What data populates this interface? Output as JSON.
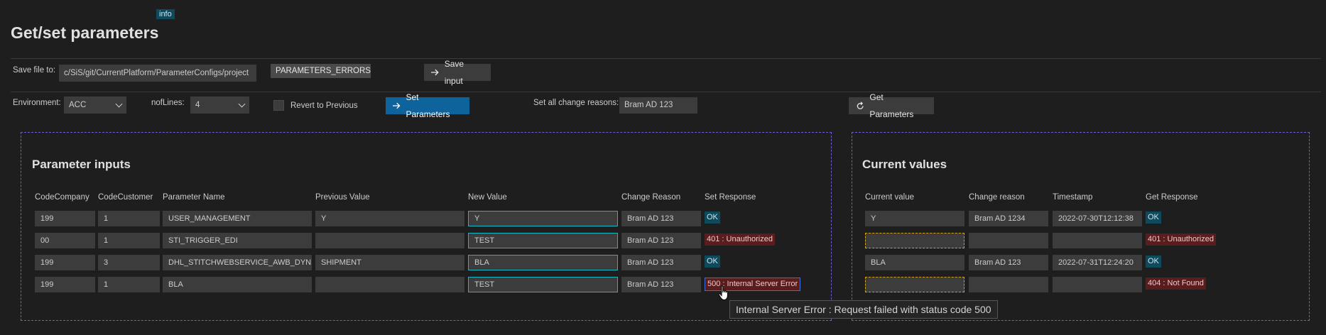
{
  "header": {
    "info_badge": "info",
    "title": "Get/set parameters"
  },
  "save_row": {
    "label": "Save file to:",
    "path": "c/SiS/git/CurrentPlatform/ParameterConfigs/project",
    "filename": "PARAMETERS_ERRORS.CSV",
    "save_button": "Save input"
  },
  "controls": {
    "environment_label": "Environment:",
    "environment_value": "ACC",
    "noflines_label": "nofLines:",
    "noflines_value": "4",
    "revert_label": "Revert to Previous",
    "set_button": "Set Parameters",
    "change_reasons_label": "Set all change reasons:",
    "change_reasons_value": "Bram AD 123",
    "get_button": "Get Parameters"
  },
  "inputs_panel": {
    "title": "Parameter inputs",
    "columns": [
      "CodeCompany",
      "CodeCustomer",
      "Parameter Name",
      "Previous Value",
      "New Value",
      "Change Reason",
      "Set Response"
    ],
    "rows": [
      {
        "code_company": "199",
        "code_customer": "1",
        "parameter_name": "USER_MANAGEMENT",
        "previous_value": "Y",
        "new_value": "Y",
        "change_reason": "Bram AD 123",
        "set_response": "OK",
        "status": "ok"
      },
      {
        "code_company": "00",
        "code_customer": "1",
        "parameter_name": "STI_TRIGGER_EDI",
        "previous_value": "",
        "new_value": "TEST",
        "change_reason": "Bram AD 123",
        "set_response": "401 : Unauthorized",
        "status": "err"
      },
      {
        "code_company": "199",
        "code_customer": "3",
        "parameter_name": "DHL_STITCHWEBSERVICE_AWB_DYNIN",
        "previous_value": "SHIPMENT",
        "new_value": "BLA",
        "change_reason": "Bram AD 123",
        "set_response": "OK",
        "status": "ok"
      },
      {
        "code_company": "199",
        "code_customer": "1",
        "parameter_name": "BLA",
        "previous_value": "",
        "new_value": "TEST",
        "change_reason": "Bram AD 123",
        "set_response": "500 : Internal Server Error",
        "status": "err"
      }
    ]
  },
  "current_panel": {
    "title": "Current values",
    "columns": [
      "Current value",
      "Change reason",
      "Timestamp",
      "Get Response"
    ],
    "rows": [
      {
        "current_value": "Y",
        "change_reason": "Bram AD 1234",
        "timestamp": "2022-07-30T12:12:38",
        "get_response": "OK",
        "status": "ok"
      },
      {
        "current_value": "",
        "change_reason": "",
        "timestamp": "",
        "get_response": "401 : Unauthorized",
        "status": "err"
      },
      {
        "current_value": "BLA",
        "change_reason": "Bram AD 123",
        "timestamp": "2022-07-31T12:24:20",
        "get_response": "OK",
        "status": "ok"
      },
      {
        "current_value": "",
        "change_reason": "",
        "timestamp": "",
        "get_response": "404 : Not Found",
        "status": "err"
      }
    ]
  },
  "tooltip": {
    "text": "Internal Server Error : Request failed with status code 500"
  },
  "icons": {
    "save": "arrow-right-icon",
    "set": "arrow-right-icon",
    "get": "refresh-icon",
    "cursor": "hand-pointer-icon"
  },
  "colors": {
    "accent": "#0e639c",
    "ok": "#0e4a5c",
    "error": "#5a1d1d",
    "new_value_border": "#15b8c4",
    "panel_border": "#6b5fd6",
    "empty_warn": "#d4a017"
  }
}
